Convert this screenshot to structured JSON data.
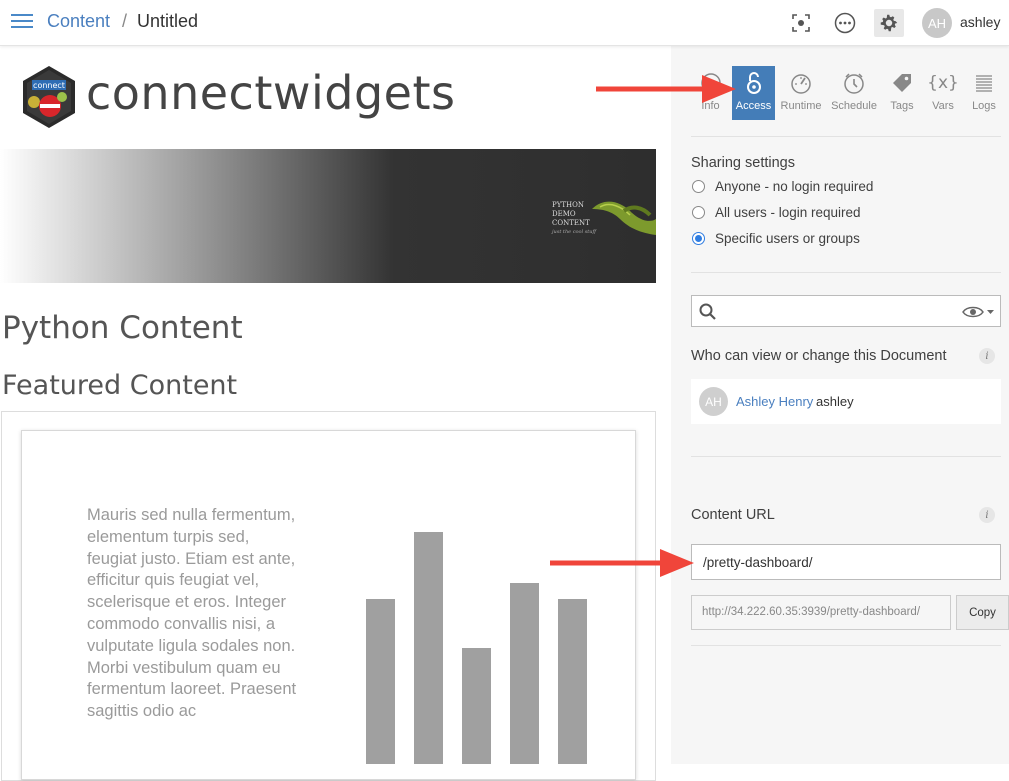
{
  "topbar": {
    "breadcrumb_root": "Content",
    "breadcrumb_sep": "/",
    "breadcrumb_current": "Untitled",
    "avatar_initials": "AH",
    "username": "ashley"
  },
  "main": {
    "brand": "connectwidgets",
    "logo_text": "connect",
    "banner_text": [
      "PYTHON",
      "DEMO",
      "CONTENT",
      "just the cool stuff"
    ],
    "heading_python": "Python Content",
    "heading_featured": "Featured Content",
    "lorem": "Mauris sed nulla fermentum, elementum turpis sed, feugiat justo. Etiam est ante, efficitur quis feugiat vel, scelerisque et eros. Integer commodo convallis nisi, a vulputate ligula sodales non. Morbi vestibulum quam eu fermentum laoreet. Praesent sagittis odio ac",
    "bar_heights": [
      0.71,
      1.0,
      0.5,
      0.78,
      0.71
    ]
  },
  "side": {
    "tabs": [
      {
        "label": "Info",
        "icon": "info-icon"
      },
      {
        "label": "Access",
        "icon": "lock-icon",
        "active": true
      },
      {
        "label": "Runtime",
        "icon": "gauge-icon"
      },
      {
        "label": "Schedule",
        "icon": "clock-icon"
      },
      {
        "label": "Tags",
        "icon": "tag-icon"
      },
      {
        "label": "Vars",
        "icon": "braces-icon"
      },
      {
        "label": "Logs",
        "icon": "list-icon"
      }
    ],
    "vars_icon_text": "{x}",
    "sharing_label": "Sharing settings",
    "sharing_options": [
      {
        "label": "Anyone - no login required",
        "selected": false
      },
      {
        "label": "All users - login required",
        "selected": false
      },
      {
        "label": "Specific users or groups",
        "selected": true
      }
    ],
    "who_label": "Who can view or change this Document",
    "info_glyph": "i",
    "user": {
      "initials": "AH",
      "name": "Ashley Henry",
      "handle": "ashley"
    },
    "content_url_label": "Content URL",
    "vanity_url": "/pretty-dashboard/",
    "full_url": "http://34.222.60.35:3939/pretty-dashboard/",
    "copy_label": "Copy"
  },
  "colors": {
    "accent": "#447db8",
    "link": "#4a7fbf",
    "arrow": "#f0453a"
  }
}
